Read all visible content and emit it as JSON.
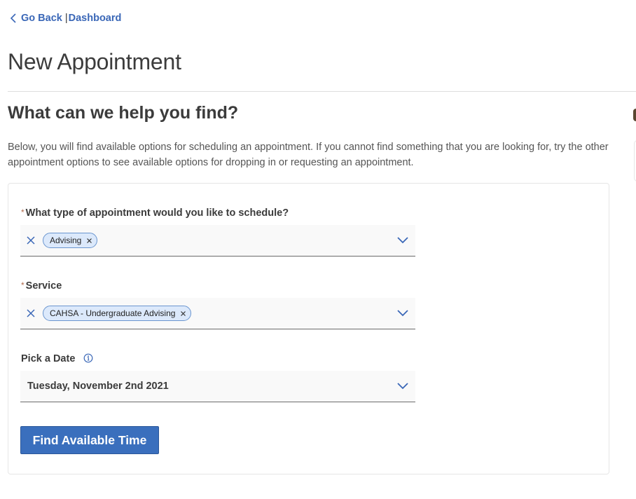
{
  "nav": {
    "back_label": "Go Back",
    "separator": "|",
    "dashboard_label": "Dashboard"
  },
  "page": {
    "title": "New Appointment",
    "section_title": "What can we help you find?",
    "intro": "Below, you will find available options for scheduling an appointment. If you cannot find something that you are looking for, try the other appointment options to see available options for dropping in or requesting an appointment."
  },
  "form": {
    "required_marker": "*",
    "appointment_type": {
      "label": "What type of appointment would you like to schedule?",
      "required": true,
      "selected_chips": [
        "Advising"
      ]
    },
    "service": {
      "label": "Service",
      "required": true,
      "selected_chips": [
        "CAHSA - Undergraduate Advising"
      ]
    },
    "date": {
      "label": "Pick a Date",
      "required": false,
      "value": "Tuesday, November 2nd 2021"
    },
    "submit_label": "Find Available Time"
  },
  "colors": {
    "link": "#3a67b7",
    "primary_button": "#3a6fbd",
    "chip_bg": "#dce9fb",
    "chip_border": "#6a95cf",
    "required_marker": "#b06a4c"
  }
}
